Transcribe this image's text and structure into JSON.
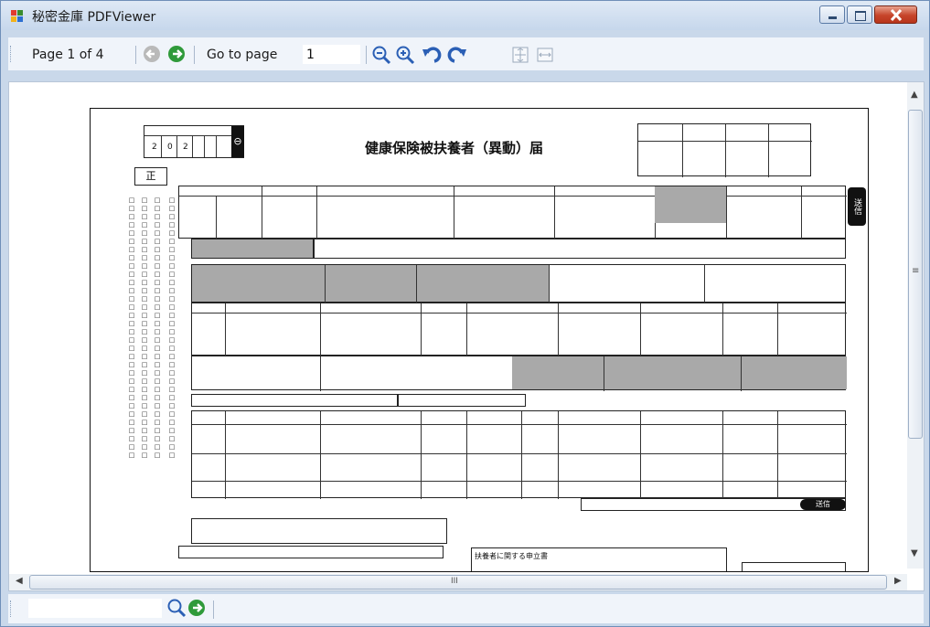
{
  "window": {
    "title": "秘密金庫 PDFViewer"
  },
  "toolbar": {
    "page_status": "Page 1 of 4",
    "goto_label": "Go to page",
    "goto_value": "1",
    "prev_icon": "back-arrow-icon",
    "next_icon": "forward-arrow-icon",
    "zoom_out_icon": "zoom-out-icon",
    "zoom_in_icon": "zoom-in-icon",
    "rotate_left_icon": "rotate-left-icon",
    "rotate_right_icon": "rotate-right-icon",
    "fit_page_icon": "fit-page-icon",
    "fit_width_icon": "fit-width-icon"
  },
  "document": {
    "title": "健康保険被扶養者（異動）届",
    "stamp_label": "正",
    "date_digits": [
      "2",
      "0",
      "2"
    ],
    "circle_mark": "⊖",
    "side_tab_top": "送信",
    "side_tab_bottom": "送信",
    "bottom_heading": "扶養者に関する申立書"
  },
  "scrollbar": {
    "horizontal_grip": "III",
    "vertical_grip": "≡"
  },
  "colors": {
    "accent_green": "#2f9a3a",
    "accent_blue": "#2b5fb5",
    "close_red": "#c6442a",
    "toolbar_bg": "#f0f4fa"
  }
}
